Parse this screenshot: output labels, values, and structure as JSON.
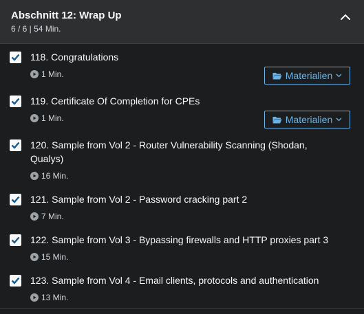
{
  "section": {
    "title": "Abschnitt 12: Wrap Up",
    "meta": "6 / 6 | 54 Min."
  },
  "lectures": [
    {
      "title": "118. Congratulations",
      "duration": "1 Min.",
      "completed": true,
      "resources_label": "Materialien"
    },
    {
      "title": "119. Certificate Of Completion for CPEs",
      "duration": "1 Min.",
      "completed": true,
      "resources_label": "Materialien"
    },
    {
      "title": "120. Sample from Vol 2 - Router Vulnerability Scanning (Shodan, Qualys)",
      "duration": "16 Min.",
      "completed": true
    },
    {
      "title": "121. Sample from Vol 2 - Password cracking part 2",
      "duration": "7 Min.",
      "completed": true
    },
    {
      "title": "122. Sample from Vol 3 - Bypassing firewalls and HTTP proxies part 3",
      "duration": "15 Min.",
      "completed": true
    },
    {
      "title": "123. Sample from Vol 4 - Email clients, protocols and authentication",
      "duration": "13 Min.",
      "completed": true
    }
  ],
  "colors": {
    "background": "#1c1d1f",
    "header_bg": "#2d2f31",
    "accent_blue": "#6bb3e5",
    "checkbox_check": "#1a5a8a"
  },
  "icons": {
    "collapse": "chevron-up-icon",
    "play": "play-circle-icon",
    "folder": "folder-open-icon",
    "dropdown": "chevron-down-icon",
    "check": "checkmark-icon"
  }
}
